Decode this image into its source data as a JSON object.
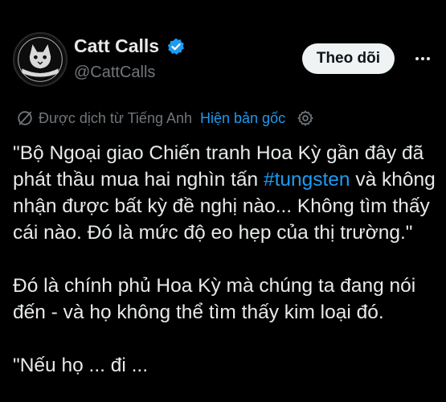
{
  "user": {
    "display_name": "Catt Calls",
    "handle": "@CattCalls",
    "verified": true,
    "avatar_text": "CATTCALLS"
  },
  "actions": {
    "follow_label": "Theo dõi",
    "more_icon": "more-horizontal-icon"
  },
  "translation": {
    "icon": "translate-icon",
    "label": "Được dịch từ Tiếng Anh",
    "show_original": "Hiện bản gốc",
    "settings_icon": "gear-icon"
  },
  "tweet": {
    "p1_part1": "\"Bộ Ngoại giao Chiến tranh Hoa Kỳ gần đây đã phát thầu mua hai nghìn tấn ",
    "hashtag": "#tungsten",
    "p1_part2": " và không nhận được bất kỳ đề nghị nào... Không tìm thấy cái nào. Đó là mức độ eo hẹp của thị trường.\"",
    "p2": "Đó là chính phủ Hoa Kỳ mà chúng ta đang nói đến - và họ không thể tìm thấy kim loại đó.",
    "p3": "\"Nếu họ ... đi ..."
  },
  "colors": {
    "background": "#000000",
    "text": "#e7e9ea",
    "secondary": "#71767b",
    "accent": "#1d9bf0"
  }
}
